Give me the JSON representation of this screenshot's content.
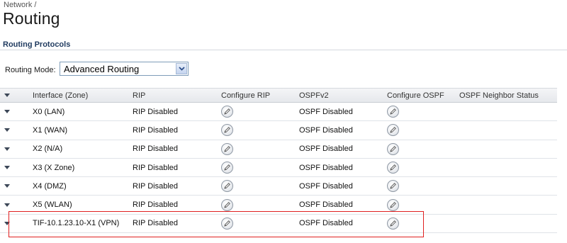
{
  "breadcrumb": "Network /",
  "page_title": "Routing",
  "section_title": "Routing Protocols",
  "routing_mode": {
    "label": "Routing Mode:",
    "value": "Advanced Routing"
  },
  "table": {
    "headers": {
      "interface": "Interface (Zone)",
      "rip": "RIP",
      "configure_rip": "Configure RIP",
      "ospf": "OSPFv2",
      "configure_ospf": "Configure OSPF",
      "neighbor_status": "OSPF Neighbor Status"
    },
    "rows": [
      {
        "interface": "X0 (LAN)",
        "rip": "RIP Disabled",
        "ospf": "OSPF Disabled",
        "neighbor_status": ""
      },
      {
        "interface": "X1 (WAN)",
        "rip": "RIP Disabled",
        "ospf": "OSPF Disabled",
        "neighbor_status": ""
      },
      {
        "interface": "X2 (N/A)",
        "rip": "RIP Disabled",
        "ospf": "OSPF Disabled",
        "neighbor_status": ""
      },
      {
        "interface": "X3 (X Zone)",
        "rip": "RIP Disabled",
        "ospf": "OSPF Disabled",
        "neighbor_status": ""
      },
      {
        "interface": "X4 (DMZ)",
        "rip": "RIP Disabled",
        "ospf": "OSPF Disabled",
        "neighbor_status": ""
      },
      {
        "interface": "X5 (WLAN)",
        "rip": "RIP Disabled",
        "ospf": "OSPF Disabled",
        "neighbor_status": ""
      },
      {
        "interface": "TIF-10.1.23.10-X1 (VPN)",
        "rip": "RIP Disabled",
        "ospf": "OSPF Disabled",
        "neighbor_status": ""
      }
    ]
  },
  "colors": {
    "highlight_border": "#e02020",
    "section_title": "#1f3a5f"
  },
  "icons": {
    "expand": "chevron-down-icon",
    "edit": "pencil-edit-icon",
    "dropdown": "dropdown-arrow-icon"
  }
}
